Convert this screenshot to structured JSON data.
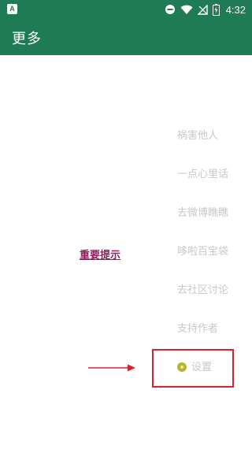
{
  "status_bar": {
    "app_icon_letter": "A",
    "time": "4:32"
  },
  "app_bar": {
    "title": "更多"
  },
  "menu": {
    "items": [
      {
        "label": "祸害他人"
      },
      {
        "label": "一点心里话"
      },
      {
        "label": "去微博瞧瞧"
      },
      {
        "label": "哆啦百宝袋"
      },
      {
        "label": "去社区讨论"
      },
      {
        "label": "支持作者"
      },
      {
        "label": "设置",
        "icon": "gear-icon"
      }
    ]
  },
  "tip": {
    "label": "重要提示"
  },
  "colors": {
    "primary": "#1f7a56",
    "menu_text": "#c8c8c8",
    "tip_text": "#8e1e5e",
    "highlight": "#e0202b"
  }
}
